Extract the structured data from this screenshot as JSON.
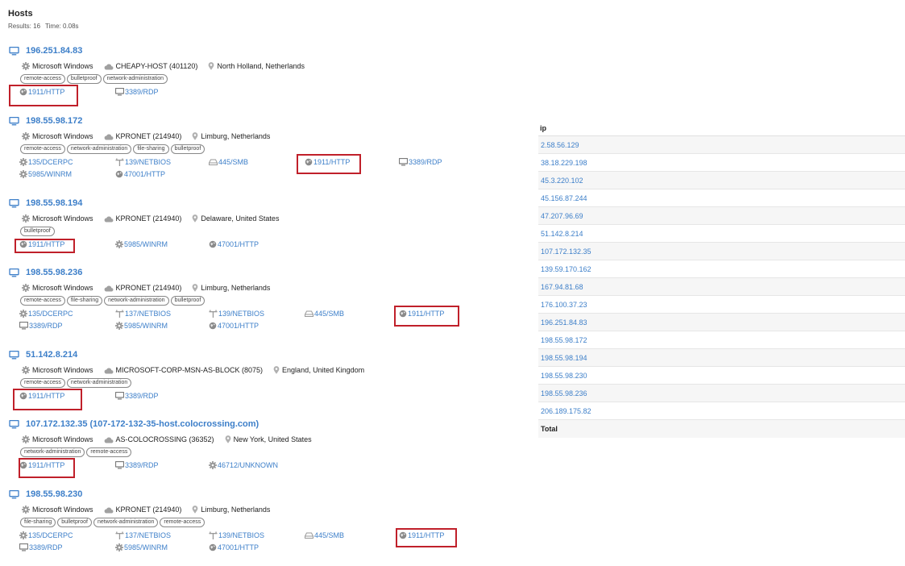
{
  "page": {
    "title": "Hosts",
    "results": "Results: 16",
    "time": "Time: 0.08s"
  },
  "colors": {
    "link": "#3d7fc9",
    "highlight": "#c0202a"
  },
  "hosts": [
    {
      "ip": "196.251.84.83",
      "os": "Microsoft Windows",
      "asn": "CHEAPY-HOST (401120)",
      "location": "North Holland, Netherlands",
      "tags": [
        "remote-access",
        "bulletproof",
        "network-administration"
      ],
      "services": [
        {
          "label": "1911/HTTP",
          "icon": "globe-icon",
          "highlighted": true
        },
        {
          "label": "3389/RDP",
          "icon": "monitor-icon"
        }
      ]
    },
    {
      "ip": "198.55.98.172",
      "os": "Microsoft Windows",
      "asn": "KPRONET (214940)",
      "location": "Limburg, Netherlands",
      "tags": [
        "remote-access",
        "network-administration",
        "file-sharing",
        "bulletproof"
      ],
      "services": [
        {
          "label": "135/DCERPC",
          "icon": "gear-icon"
        },
        {
          "label": "139/NETBIOS",
          "icon": "network-icon"
        },
        {
          "label": "445/SMB",
          "icon": "drive-icon"
        },
        {
          "label": "1911/HTTP",
          "icon": "globe-icon",
          "highlighted": true
        },
        {
          "label": "3389/RDP",
          "icon": "monitor-icon"
        },
        {
          "label": "5985/WINRM",
          "icon": "gear-icon"
        },
        {
          "label": "47001/HTTP",
          "icon": "globe-icon"
        }
      ]
    },
    {
      "ip": "198.55.98.194",
      "os": "Microsoft Windows",
      "asn": "KPRONET (214940)",
      "location": "Delaware, United States",
      "tags": [
        "bulletproof"
      ],
      "services": [
        {
          "label": "1911/HTTP",
          "icon": "globe-icon",
          "highlighted": true
        },
        {
          "label": "5985/WINRM",
          "icon": "gear-icon"
        },
        {
          "label": "47001/HTTP",
          "icon": "globe-icon"
        }
      ]
    },
    {
      "ip": "198.55.98.236",
      "os": "Microsoft Windows",
      "asn": "KPRONET (214940)",
      "location": "Limburg, Netherlands",
      "tags": [
        "remote-access",
        "file-sharing",
        "network-administration",
        "bulletproof"
      ],
      "services": [
        {
          "label": "135/DCERPC",
          "icon": "gear-icon"
        },
        {
          "label": "137/NETBIOS",
          "icon": "network-icon"
        },
        {
          "label": "139/NETBIOS",
          "icon": "network-icon"
        },
        {
          "label": "445/SMB",
          "icon": "drive-icon"
        },
        {
          "label": "1911/HTTP",
          "icon": "globe-icon",
          "highlighted": true
        },
        {
          "label": "3389/RDP",
          "icon": "monitor-icon"
        },
        {
          "label": "5985/WINRM",
          "icon": "gear-icon"
        },
        {
          "label": "47001/HTTP",
          "icon": "globe-icon"
        }
      ]
    },
    {
      "ip": "51.142.8.214",
      "os": "Microsoft Windows",
      "asn": "MICROSOFT-CORP-MSN-AS-BLOCK (8075)",
      "location": "England, United Kingdom",
      "tags": [
        "remote-access",
        "network-administration"
      ],
      "services": [
        {
          "label": "1911/HTTP",
          "icon": "globe-icon",
          "highlighted": true
        },
        {
          "label": "3389/RDP",
          "icon": "monitor-icon"
        }
      ]
    },
    {
      "ip": "107.172.132.35 (107-172-132-35-host.colocrossing.com)",
      "os": "Microsoft Windows",
      "asn": "AS-COLOCROSSING (36352)",
      "location": "New York, United States",
      "tags": [
        "network-administration",
        "remote-access"
      ],
      "services": [
        {
          "label": "1911/HTTP",
          "icon": "globe-icon",
          "highlighted": true
        },
        {
          "label": "3389/RDP",
          "icon": "monitor-icon"
        },
        {
          "label": "46712/UNKNOWN",
          "icon": "gear-icon"
        }
      ]
    },
    {
      "ip": "198.55.98.230",
      "os": "Microsoft Windows",
      "asn": "KPRONET (214940)",
      "location": "Limburg, Netherlands",
      "tags": [
        "file-sharing",
        "bulletproof",
        "network-administration",
        "remote-access"
      ],
      "services": [
        {
          "label": "135/DCERPC",
          "icon": "gear-icon"
        },
        {
          "label": "137/NETBIOS",
          "icon": "network-icon"
        },
        {
          "label": "139/NETBIOS",
          "icon": "network-icon"
        },
        {
          "label": "445/SMB",
          "icon": "drive-icon"
        },
        {
          "label": "1911/HTTP",
          "icon": "globe-icon",
          "highlighted": true
        },
        {
          "label": "3389/RDP",
          "icon": "monitor-icon"
        },
        {
          "label": "5985/WINRM",
          "icon": "gear-icon"
        },
        {
          "label": "47001/HTTP",
          "icon": "globe-icon"
        }
      ]
    }
  ],
  "ip_table": {
    "header": "ip",
    "rows": [
      "2.58.56.129",
      "38.18.229.198",
      "45.3.220.102",
      "45.156.87.244",
      "47.207.96.69",
      "51.142.8.214",
      "107.172.132.35",
      "139.59.170.162",
      "167.94.81.68",
      "176.100.37.23",
      "196.251.84.83",
      "198.55.98.172",
      "198.55.98.194",
      "198.55.98.230",
      "198.55.98.236",
      "206.189.175.82"
    ],
    "total_label": "Total"
  }
}
